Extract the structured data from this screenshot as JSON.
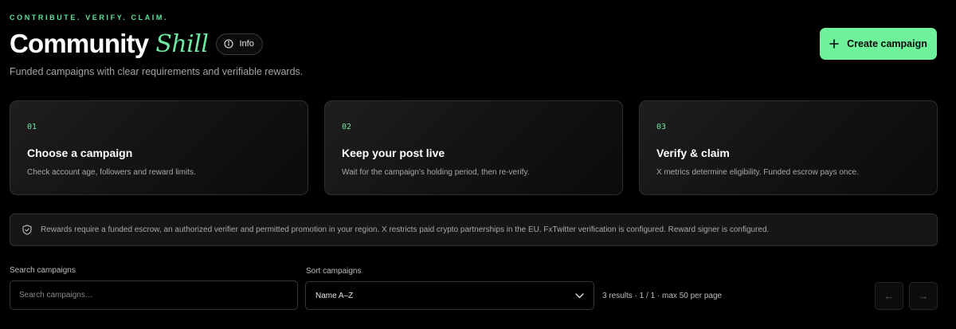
{
  "header": {
    "eyebrow": "CONTRIBUTE. VERIFY. CLAIM.",
    "title_main": "Community",
    "title_accent": "Shill",
    "info_label": "Info",
    "subtitle": "Funded campaigns with clear requirements and verifiable rewards.",
    "create_label": "Create campaign"
  },
  "steps": [
    {
      "num": "01",
      "title": "Choose a campaign",
      "desc": "Check account age, followers and reward limits."
    },
    {
      "num": "02",
      "title": "Keep your post live",
      "desc": "Wait for the campaign’s holding period, then re-verify."
    },
    {
      "num": "03",
      "title": "Verify & claim",
      "desc": "X metrics determine eligibility. Funded escrow pays once."
    }
  ],
  "notice": {
    "text": "Rewards require a funded escrow, an authorized verifier and permitted promotion in your region. X restricts paid crypto partnerships in the EU. FxTwitter verification is configured. Reward signer is configured."
  },
  "filters": {
    "search_label": "Search campaigns",
    "search_placeholder": "Search campaigns…",
    "sort_label": "Sort campaigns",
    "sort_value": "Name A–Z",
    "results_text": "3 results · 1 / 1 · max 50 per page",
    "prev_glyph": "←",
    "next_glyph": "→"
  },
  "icons": {
    "info": "info-circle-icon",
    "create": "plus-icon",
    "notice": "shield-check-icon",
    "sort": "chevron-down-icon"
  },
  "colors": {
    "accent": "#6ef39a",
    "background": "#000000",
    "card": "#161616"
  }
}
